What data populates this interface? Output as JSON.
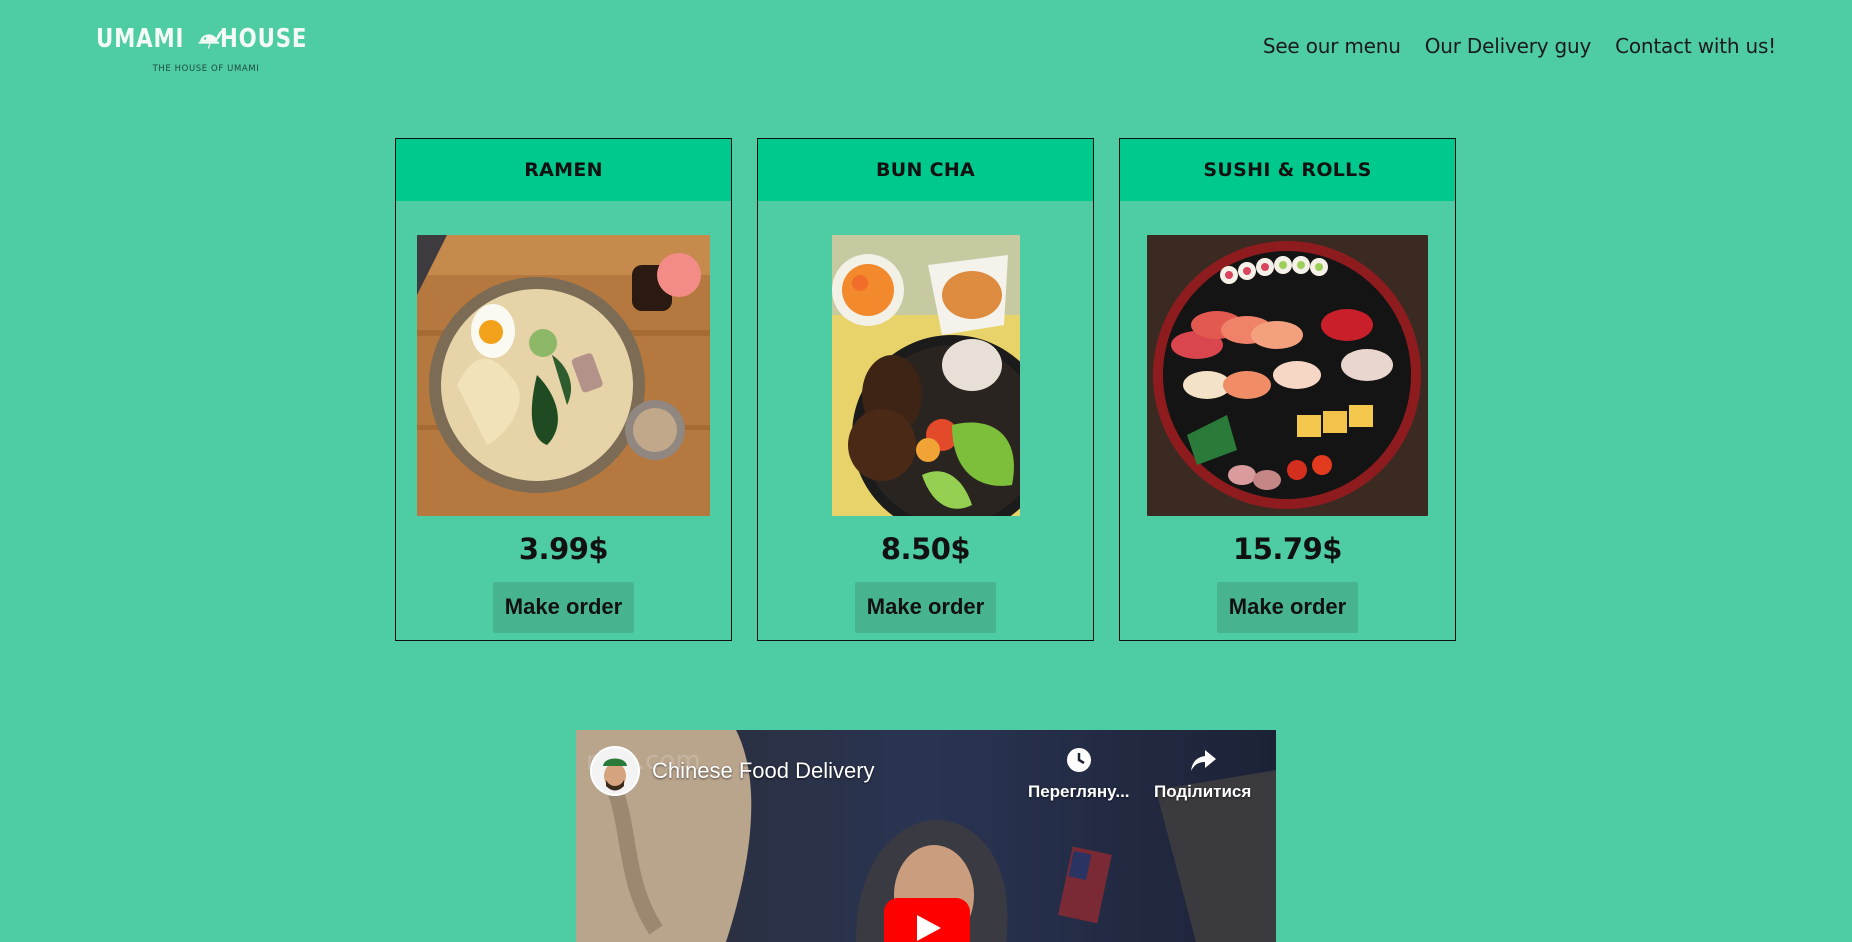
{
  "header": {
    "logo": {
      "left_word": "UMAMI",
      "right_word": "HOUSE",
      "tagline": "THE HOUSE OF UMAMI",
      "icon": "cloche-leaf-icon"
    },
    "nav": [
      {
        "label": "See our menu"
      },
      {
        "label": "Our Delivery guy"
      },
      {
        "label": "Contact with us!"
      }
    ]
  },
  "menu": [
    {
      "title": "RAMEN",
      "price": "3.99$",
      "button": "Make order",
      "image": "ramen-bowl-photo"
    },
    {
      "title": "BUN CHA",
      "price": "8.50$",
      "button": "Make order",
      "image": "bun-cha-plate-photo"
    },
    {
      "title": "SUSHI & ROLLS",
      "price": "15.79$",
      "button": "Make order",
      "image": "sushi-platter-photo"
    }
  ],
  "video": {
    "title": "Chinese Food Delivery",
    "watch_later": "Переглянy...",
    "share": "Поділитися",
    "watermark": "ring.com"
  },
  "colors": {
    "page_bg": "#4ecca3",
    "card_header": "#00c98d",
    "button_bg": "#48b48f"
  }
}
